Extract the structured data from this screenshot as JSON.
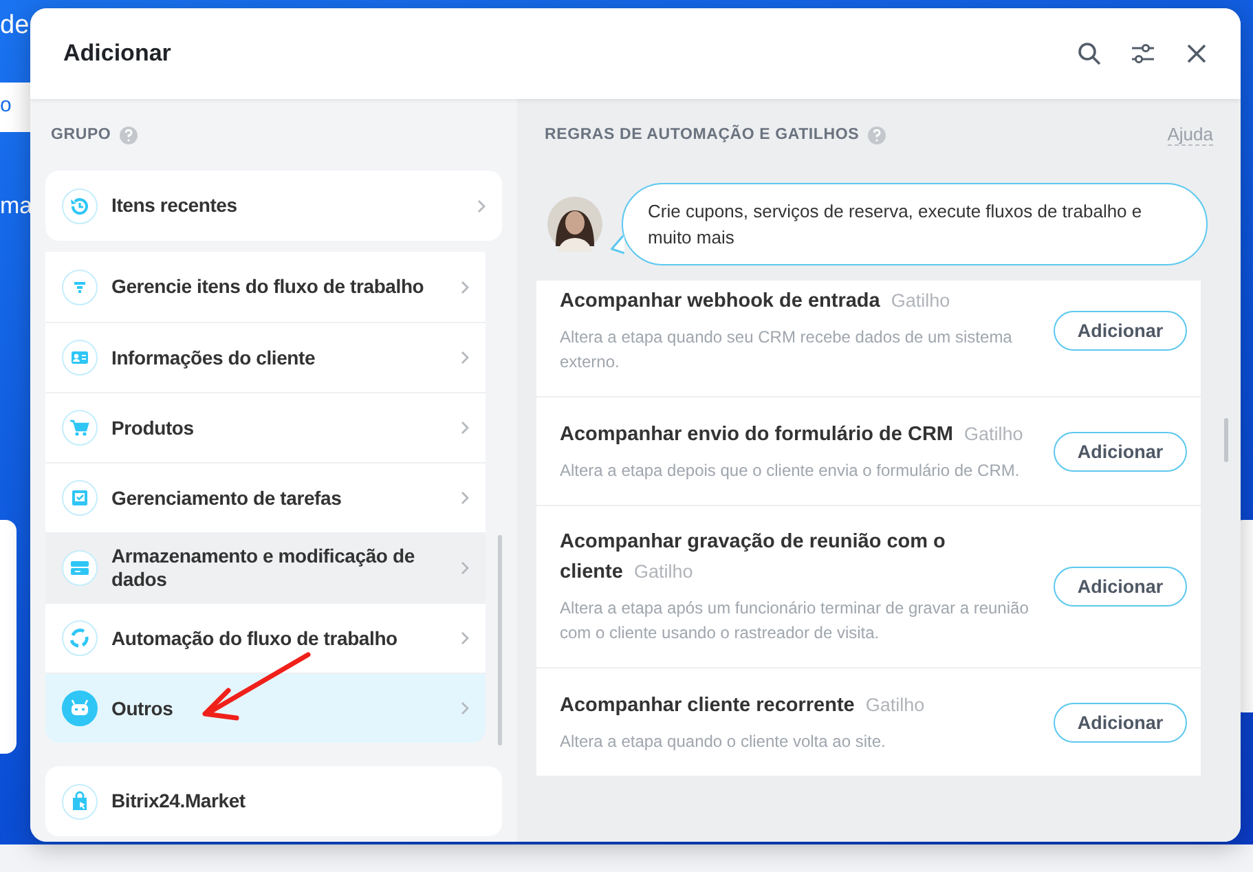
{
  "background": {
    "fragments": [
      "de",
      "o",
      "ma"
    ]
  },
  "modal": {
    "title": "Adicionar"
  },
  "groups": {
    "heading": "GRUPO",
    "recent": {
      "label": "Itens recentes"
    },
    "items": [
      {
        "label": "Gerencie itens do fluxo de trabalho",
        "selected": false,
        "highlighted": false
      },
      {
        "label": "Informações do cliente",
        "selected": false,
        "highlighted": false
      },
      {
        "label": "Produtos",
        "selected": false,
        "highlighted": false
      },
      {
        "label": "Gerenciamento de tarefas",
        "selected": false,
        "highlighted": false
      },
      {
        "label": "Armazenamento e modificação de dados",
        "selected": false,
        "highlighted": true
      },
      {
        "label": "Automação do fluxo de trabalho",
        "selected": false,
        "highlighted": false
      },
      {
        "label": "Outros",
        "selected": true,
        "highlighted": false
      }
    ],
    "market": {
      "label": "Bitrix24.Market"
    }
  },
  "rules": {
    "heading": "REGRAS DE AUTOMAÇÃO E GATILHOS",
    "help": "Ajuda",
    "tip": "Crie cupons, serviços de reserva, execute fluxos de trabalho e muito mais",
    "cards": [
      {
        "title": "Acompanhar webhook de entrada",
        "tag": "Gatilho",
        "description": "Altera a etapa quando seu CRM recebe dados de um sistema externo.",
        "button": "Adicionar"
      },
      {
        "title": "Acompanhar envio do formulário de CRM",
        "tag": "Gatilho",
        "description": "Altera a etapa depois que o cliente envia o formulário de CRM.",
        "button": "Adicionar"
      },
      {
        "title": "Acompanhar gravação de reunião com o cliente",
        "tag": "Gatilho",
        "description": "Altera a etapa após um funcionário terminar de gravar a reunião com o cliente usando o rastreador de visita.",
        "button": "Adicionar"
      },
      {
        "title": "Acompanhar cliente recorrente",
        "tag": "Gatilho",
        "description": "Altera a etapa quando o cliente volta ao site.",
        "button": "Adicionar"
      }
    ]
  }
}
